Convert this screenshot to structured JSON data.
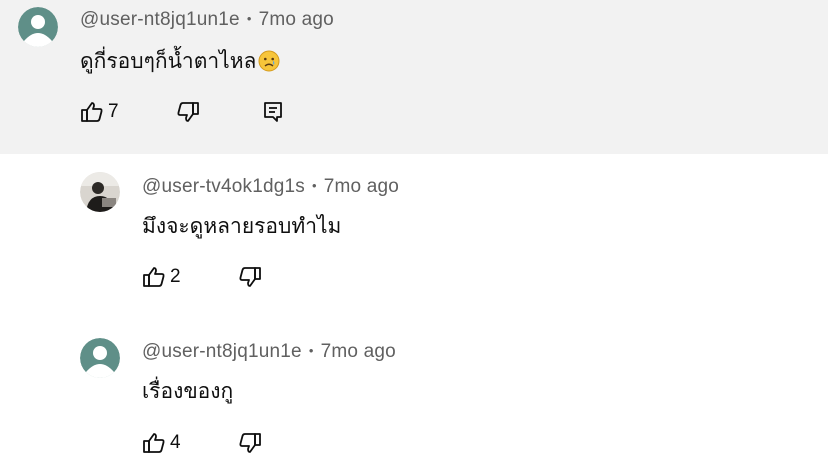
{
  "comments": [
    {
      "author": "@user-nt8jq1un1e",
      "time": "7mo ago",
      "text": "ดูกี่รอบๆก็น้ำตาไหล",
      "emoji": "😢",
      "likes": "7",
      "highlighted": true,
      "has_reply_button": true
    },
    {
      "author": "@user-tv4ok1dg1s",
      "time": "7mo ago",
      "text": "มึงจะดูหลายรอบทำไม",
      "likes": "2",
      "highlighted": false,
      "has_reply_button": false
    },
    {
      "author": "@user-nt8jq1un1e",
      "time": "7mo ago",
      "text": "เรื่องของกู",
      "likes": "4",
      "highlighted": false,
      "has_reply_button": false
    }
  ],
  "separator": "•",
  "icons": {
    "like": "thumb-up-icon",
    "dislike": "thumb-down-icon",
    "reply": "comment-reply-icon",
    "avatar_default": "default-avatar-icon",
    "emoji": "crying-face-emoji"
  },
  "colors": {
    "highlight_bg": "#f2f2f2",
    "avatar_teal": "#5f8f88",
    "meta_text": "#606060"
  }
}
